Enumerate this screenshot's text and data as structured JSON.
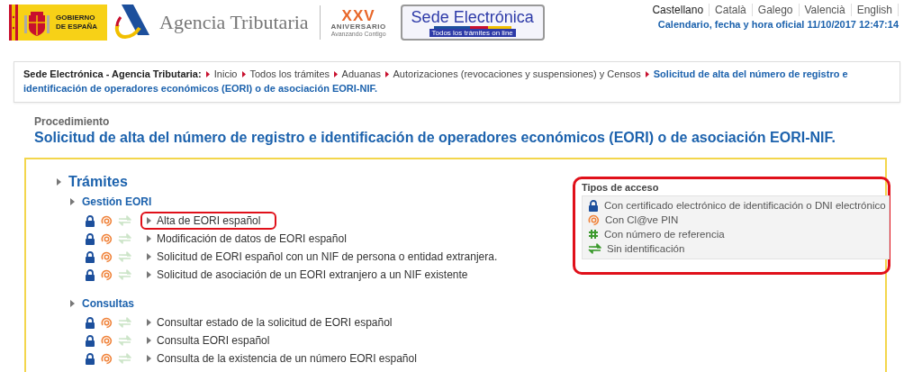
{
  "header": {
    "government": {
      "line1": "GOBIERNO",
      "line2": "DE ESPAÑA"
    },
    "agency": "Agencia Tributaria",
    "anniversary": {
      "mark": "XXV",
      "label": "ANIVERSARIO",
      "tagline": "Avanzando Contigo"
    },
    "sede": {
      "title": "Sede Electrónica",
      "tagline": "Todos los trámites on line"
    },
    "languages": [
      {
        "label": "Castellano",
        "selected": true
      },
      {
        "label": "Català",
        "selected": false
      },
      {
        "label": "Galego",
        "selected": false
      },
      {
        "label": "Valencià",
        "selected": false
      },
      {
        "label": "English",
        "selected": false
      }
    ],
    "clock": "Calendario, fecha y hora oficial 11/10/2017 12:47:14"
  },
  "breadcrumb": {
    "root": "Sede Electrónica - Agencia Tributaria:",
    "items": [
      {
        "label": "Inicio",
        "current": false
      },
      {
        "label": "Todos los trámites",
        "current": false
      },
      {
        "label": "Aduanas",
        "current": false
      },
      {
        "label": "Autorizaciones (revocaciones y suspensiones) y Censos",
        "current": false
      },
      {
        "label": "Solicitud de alta del número de registro e identificación de operadores económicos (EORI) o de asociación EORI-NIF.",
        "current": true
      }
    ]
  },
  "procedure": {
    "kicker": "Procedimiento",
    "title": "Solicitud de alta del número de registro e identificación de operadores económicos (EORI) o de asociación EORI-NIF."
  },
  "tramites": {
    "title": "Trámites",
    "sections": [
      {
        "title": "Gestión EORI",
        "children": [
          {
            "label": "Alta de EORI español",
            "certificate": true,
            "clave": true,
            "no_id": false,
            "highlighted": true
          },
          {
            "label": "Modificación de datos de EORI español",
            "certificate": true,
            "clave": true,
            "no_id": false,
            "highlighted": false
          },
          {
            "label": "Solicitud de EORI español con un NIF de persona o entidad extranjera.",
            "certificate": true,
            "clave": true,
            "no_id": false,
            "highlighted": false
          },
          {
            "label": "Solicitud de asociación de un EORI extranjero a un NIF existente",
            "certificate": true,
            "clave": true,
            "no_id": false,
            "highlighted": false
          }
        ]
      },
      {
        "title": "Consultas",
        "children": [
          {
            "label": "Consultar estado de la solicitud de EORI español",
            "certificate": true,
            "clave": true,
            "no_id": false,
            "highlighted": false
          },
          {
            "label": "Consulta EORI español",
            "certificate": true,
            "clave": true,
            "no_id": false,
            "highlighted": false
          },
          {
            "label": "Consulta de la existencia de un número EORI español",
            "certificate": true,
            "clave": true,
            "no_id": false,
            "highlighted": false
          }
        ]
      }
    ]
  },
  "access_types": {
    "title": "Tipos de acceso",
    "highlighted": true,
    "items": [
      {
        "kind": "certificate",
        "label": "Con certificado electrónico de identificación o DNI electrónico"
      },
      {
        "kind": "clave",
        "label": "Con Cl@ve PIN"
      },
      {
        "kind": "reference",
        "label": "Con número de referencia"
      },
      {
        "kind": "no_id",
        "label": "Sin identificación"
      }
    ]
  }
}
